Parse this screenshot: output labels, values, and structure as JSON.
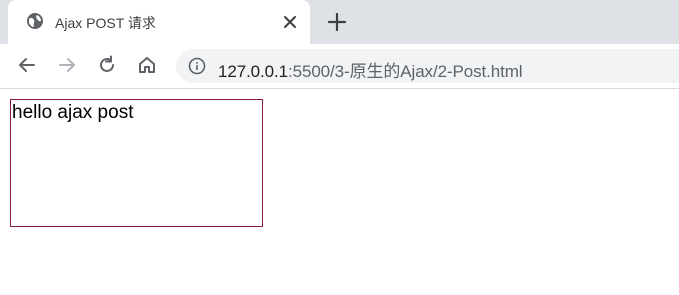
{
  "browser": {
    "tab": {
      "title": "Ajax POST 请求",
      "favicon": "globe-icon"
    },
    "toolbar": {
      "url_host": "127.0.0.1",
      "url_rest": ":5500/3-原生的Ajax/2-Post.html"
    }
  },
  "page": {
    "result_text": "hello ajax post",
    "box_border_color": "#8b1a3a"
  }
}
